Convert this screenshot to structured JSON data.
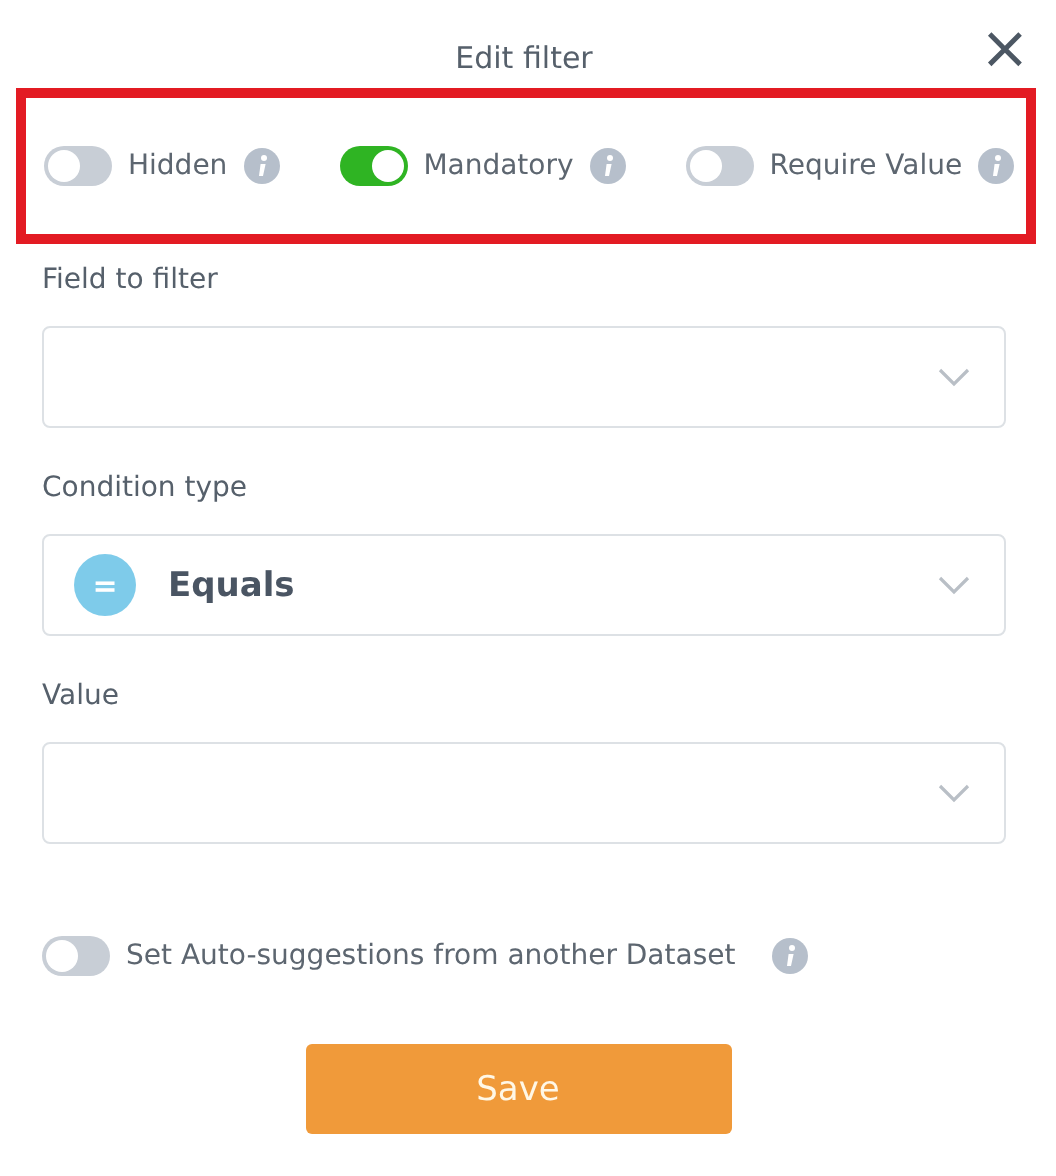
{
  "dialog": {
    "title": "Edit filter",
    "close": "×"
  },
  "toggles": [
    {
      "label": "Hidden",
      "on": false
    },
    {
      "label": "Mandatory",
      "on": true
    },
    {
      "label": "Require Value",
      "on": false
    }
  ],
  "fields": [
    {
      "label": "Field to filter"
    },
    {
      "label": "Condition type",
      "value": "Equals",
      "badge": "="
    },
    {
      "label": "Value"
    }
  ],
  "auto_suggestions": {
    "label": "Set Auto-suggestions from another Dataset",
    "on": false
  },
  "save_button": "Save"
}
